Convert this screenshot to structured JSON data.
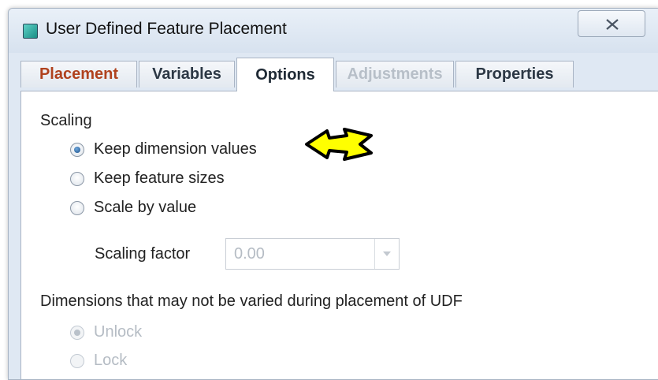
{
  "window": {
    "title": "User Defined Feature Placement",
    "close_label": "Close"
  },
  "tabs": [
    {
      "label": "Placement",
      "active": false,
      "enabled": true
    },
    {
      "label": "Variables",
      "active": false,
      "enabled": true
    },
    {
      "label": "Options",
      "active": true,
      "enabled": true
    },
    {
      "label": "Adjustments",
      "active": false,
      "enabled": false
    },
    {
      "label": "Properties",
      "active": false,
      "enabled": true
    }
  ],
  "scaling": {
    "heading": "Scaling",
    "options": [
      {
        "label": "Keep dimension values",
        "selected": true
      },
      {
        "label": "Keep feature sizes",
        "selected": false
      },
      {
        "label": "Scale by value",
        "selected": false
      }
    ],
    "factor_label": "Scaling factor",
    "factor_value": "0.00"
  },
  "dimensions": {
    "heading": "Dimensions that may not be varied during placement of UDF",
    "options": [
      {
        "label": "Unlock",
        "selected": true,
        "enabled": false
      },
      {
        "label": "Lock",
        "selected": false,
        "enabled": false
      }
    ]
  },
  "colors": {
    "active_tab_accent": "#b0421e",
    "annotation_arrow": "#ffff00"
  },
  "icons": {
    "window_icon": "app-icon",
    "close": "close-icon",
    "dropdown": "chevron-down-icon",
    "annotation": "arrow-icon"
  }
}
